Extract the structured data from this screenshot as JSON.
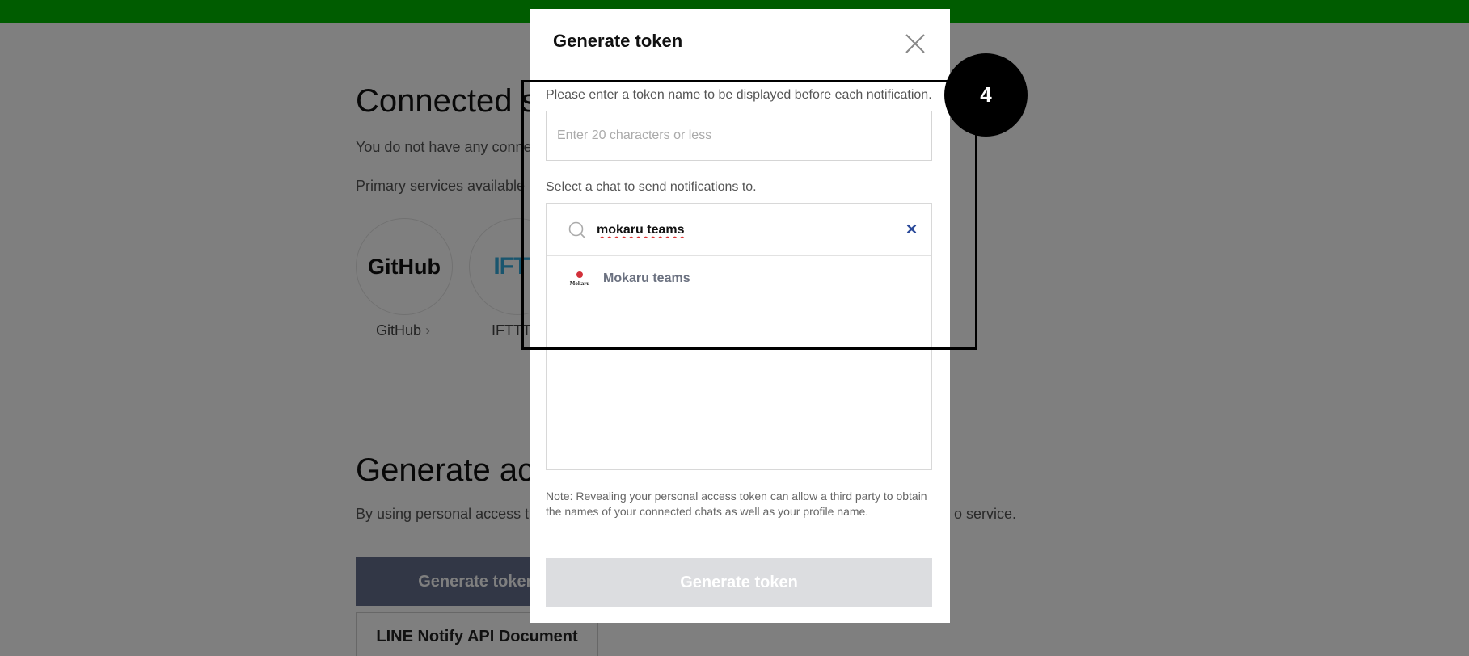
{
  "background": {
    "connected_title": "Connected s",
    "no_services_text": "You do not have any conne",
    "primary_services_text": "Primary services available",
    "services": [
      {
        "logo": "GitHub",
        "label": "GitHub",
        "chevron": "›"
      },
      {
        "logo": "IFTT",
        "label": "IFTTT"
      }
    ],
    "generate_title": "Generate acc",
    "generate_desc_left": "By using personal access t",
    "generate_desc_right": "o service.",
    "generate_button": "Generate token",
    "api_doc_button": "LINE Notify API Document"
  },
  "modal": {
    "title": "Generate token",
    "token_name_label": "Please enter a token name to be displayed before each notification.",
    "token_name_placeholder": "Enter 20 characters or less",
    "chat_label": "Select a chat to send notifications to.",
    "search_value": "mokaru teams",
    "results": [
      {
        "label": "Mokaru teams",
        "avatar_text": "Mokaru"
      }
    ],
    "note": "Note: Revealing your personal access token can allow a third party to obtain the names of your connected chats as well as your profile name.",
    "generate_button": "Generate token"
  },
  "annotation": {
    "step": "4"
  },
  "colors": {
    "topbar": "#00b900",
    "dark_button": "#646e8c",
    "disabled_button": "#dcdde0",
    "clear_icon": "#2b4a9a"
  }
}
